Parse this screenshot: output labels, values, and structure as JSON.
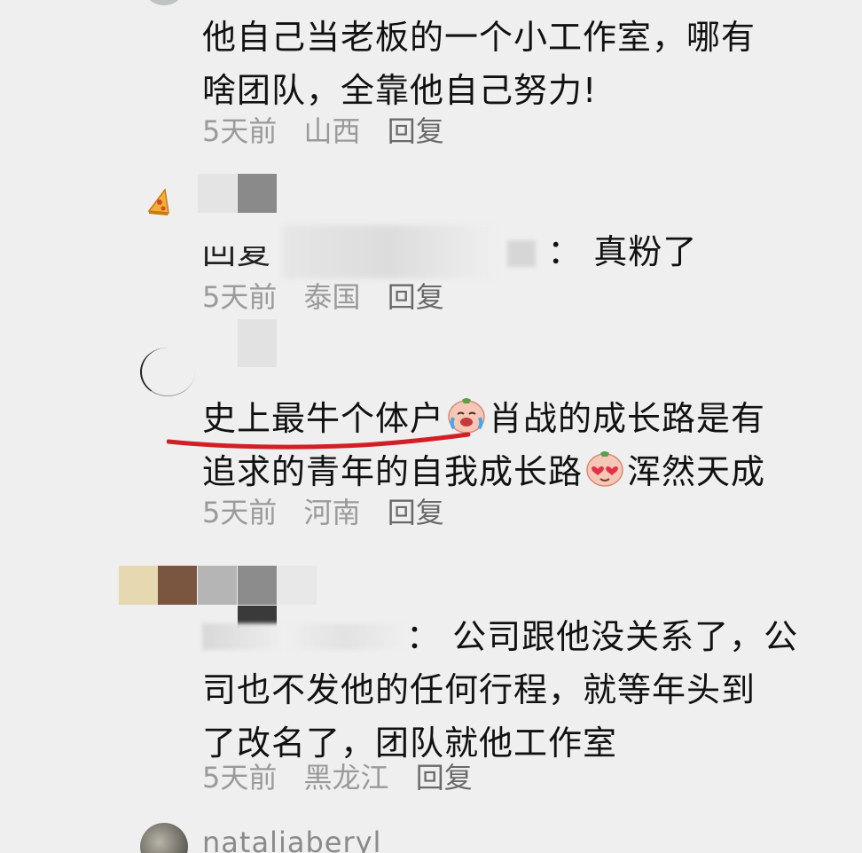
{
  "comments": [
    {
      "text_line1": "他自己当老板的一个小工作室，哪有",
      "text_line2": "啥团队，全靠他自己努力!",
      "time": "5天前",
      "location": "山西",
      "reply_label": "回复"
    },
    {
      "reply_prefix": "回复",
      "reply_text": "：  真粉了",
      "time": "5天前",
      "location": "泰国",
      "reply_label": "回复"
    },
    {
      "text_line1_a": "史上最牛个体户",
      "text_line1_b": "肖战的成长路是有",
      "text_line2_a": "追求的青年的自我成长路",
      "text_line2_b": "浑然天成",
      "time": "5天前",
      "location": "河南",
      "reply_label": "回复"
    },
    {
      "reply_text_line1": "：  公司跟他没关系了，公",
      "text_line2": "司也不发他的任何行程，就等年头到",
      "text_line3": "了改名了，团队就他工作室",
      "time": "5天前",
      "location": "黑龙江",
      "reply_label": "回复"
    }
  ],
  "next_username": "nataliaberyl",
  "colors": {
    "background": "#efefef",
    "text": "#111111",
    "meta": "#9a9a9a",
    "underline": "#d21f26"
  },
  "icons": {
    "pizza": "pizza-icon",
    "crying_laugh": "crying-face-emoji",
    "heart_eyes": "heart-eyes-emoji"
  }
}
